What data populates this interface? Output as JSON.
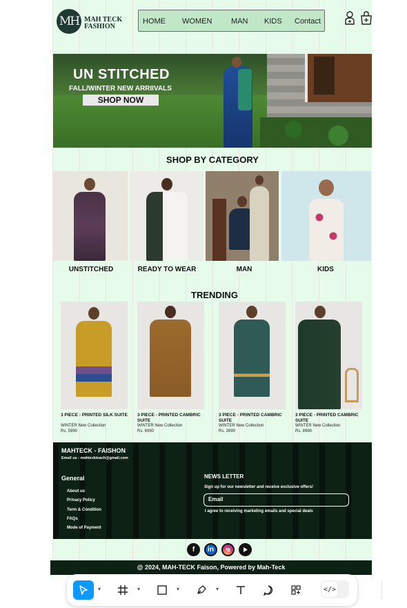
{
  "brand": {
    "monogram": "MH",
    "name_line1": "MAH TECK",
    "name_line2": "FASHION"
  },
  "nav": {
    "items": [
      "HOME",
      "WOMEN",
      "MAN",
      "KIDS",
      "Contact"
    ]
  },
  "header_icons": [
    "user-plus-icon",
    "cart-icon"
  ],
  "hero": {
    "title": "UN STITCHED",
    "subtitle": "FALL/WINTER NEW ARRIIVALS",
    "cta": "SHOP NOW"
  },
  "categories": {
    "title": "SHOP BY CATEGORY",
    "items": [
      {
        "label": "UNSTITCHED"
      },
      {
        "label": "READY TO WEAR"
      },
      {
        "label": "MAN"
      },
      {
        "label": "KIDS"
      }
    ]
  },
  "trending": {
    "title": "TRENDING",
    "items": [
      {
        "name": "3 PIECE - PRINTED SILK SUITE",
        "collection": "WINTER New Collection",
        "price": "Rs. 5990"
      },
      {
        "name": "3 PIECE - PRINTED CAMBRIC SUITE",
        "collection": "WINTER New Collection",
        "price": "Rs. 6990"
      },
      {
        "name": "3 PIECE - PRINTED CAMBRIC SUITE",
        "collection": "WINTER New Collection",
        "price": "Rs. 3990"
      },
      {
        "name": "3 PIECE - PRINTED CAMBRIC SUITE",
        "collection": "WINTER New Collection",
        "price": "Rs. 8990"
      }
    ]
  },
  "footer": {
    "brand": "MAHTECK - FAISHON",
    "email": "Email us : mahteckteach@gmail.com",
    "general_title": "General",
    "links": [
      "About us",
      "Privacy Policy",
      "Term & Condition",
      "FAQs",
      "Mode of Payment"
    ],
    "newsletter_title": "NEWS LETTER",
    "newsletter_sub": "Sign up for our newsletter and receive exclusive offers!",
    "email_placeholder": "Email",
    "consent": "I agree to receiving marketing emails and special deals"
  },
  "social": [
    "f",
    "in",
    "ig",
    "yt"
  ],
  "copyright": "@ 2024, MAH-TECK Faison, Powered by Mah-Teck",
  "toolbar": {
    "tools": [
      "move-tool",
      "frame-tool",
      "shape-tool",
      "pen-tool",
      "text-tool",
      "comment-tool",
      "assets-tool"
    ],
    "code_label": "</>"
  },
  "colors": {
    "page_bg": "#e6fbea",
    "footer_bg": "#0d2214",
    "nav_bg": "#bfe7c8",
    "accent": "#0d99ff"
  }
}
